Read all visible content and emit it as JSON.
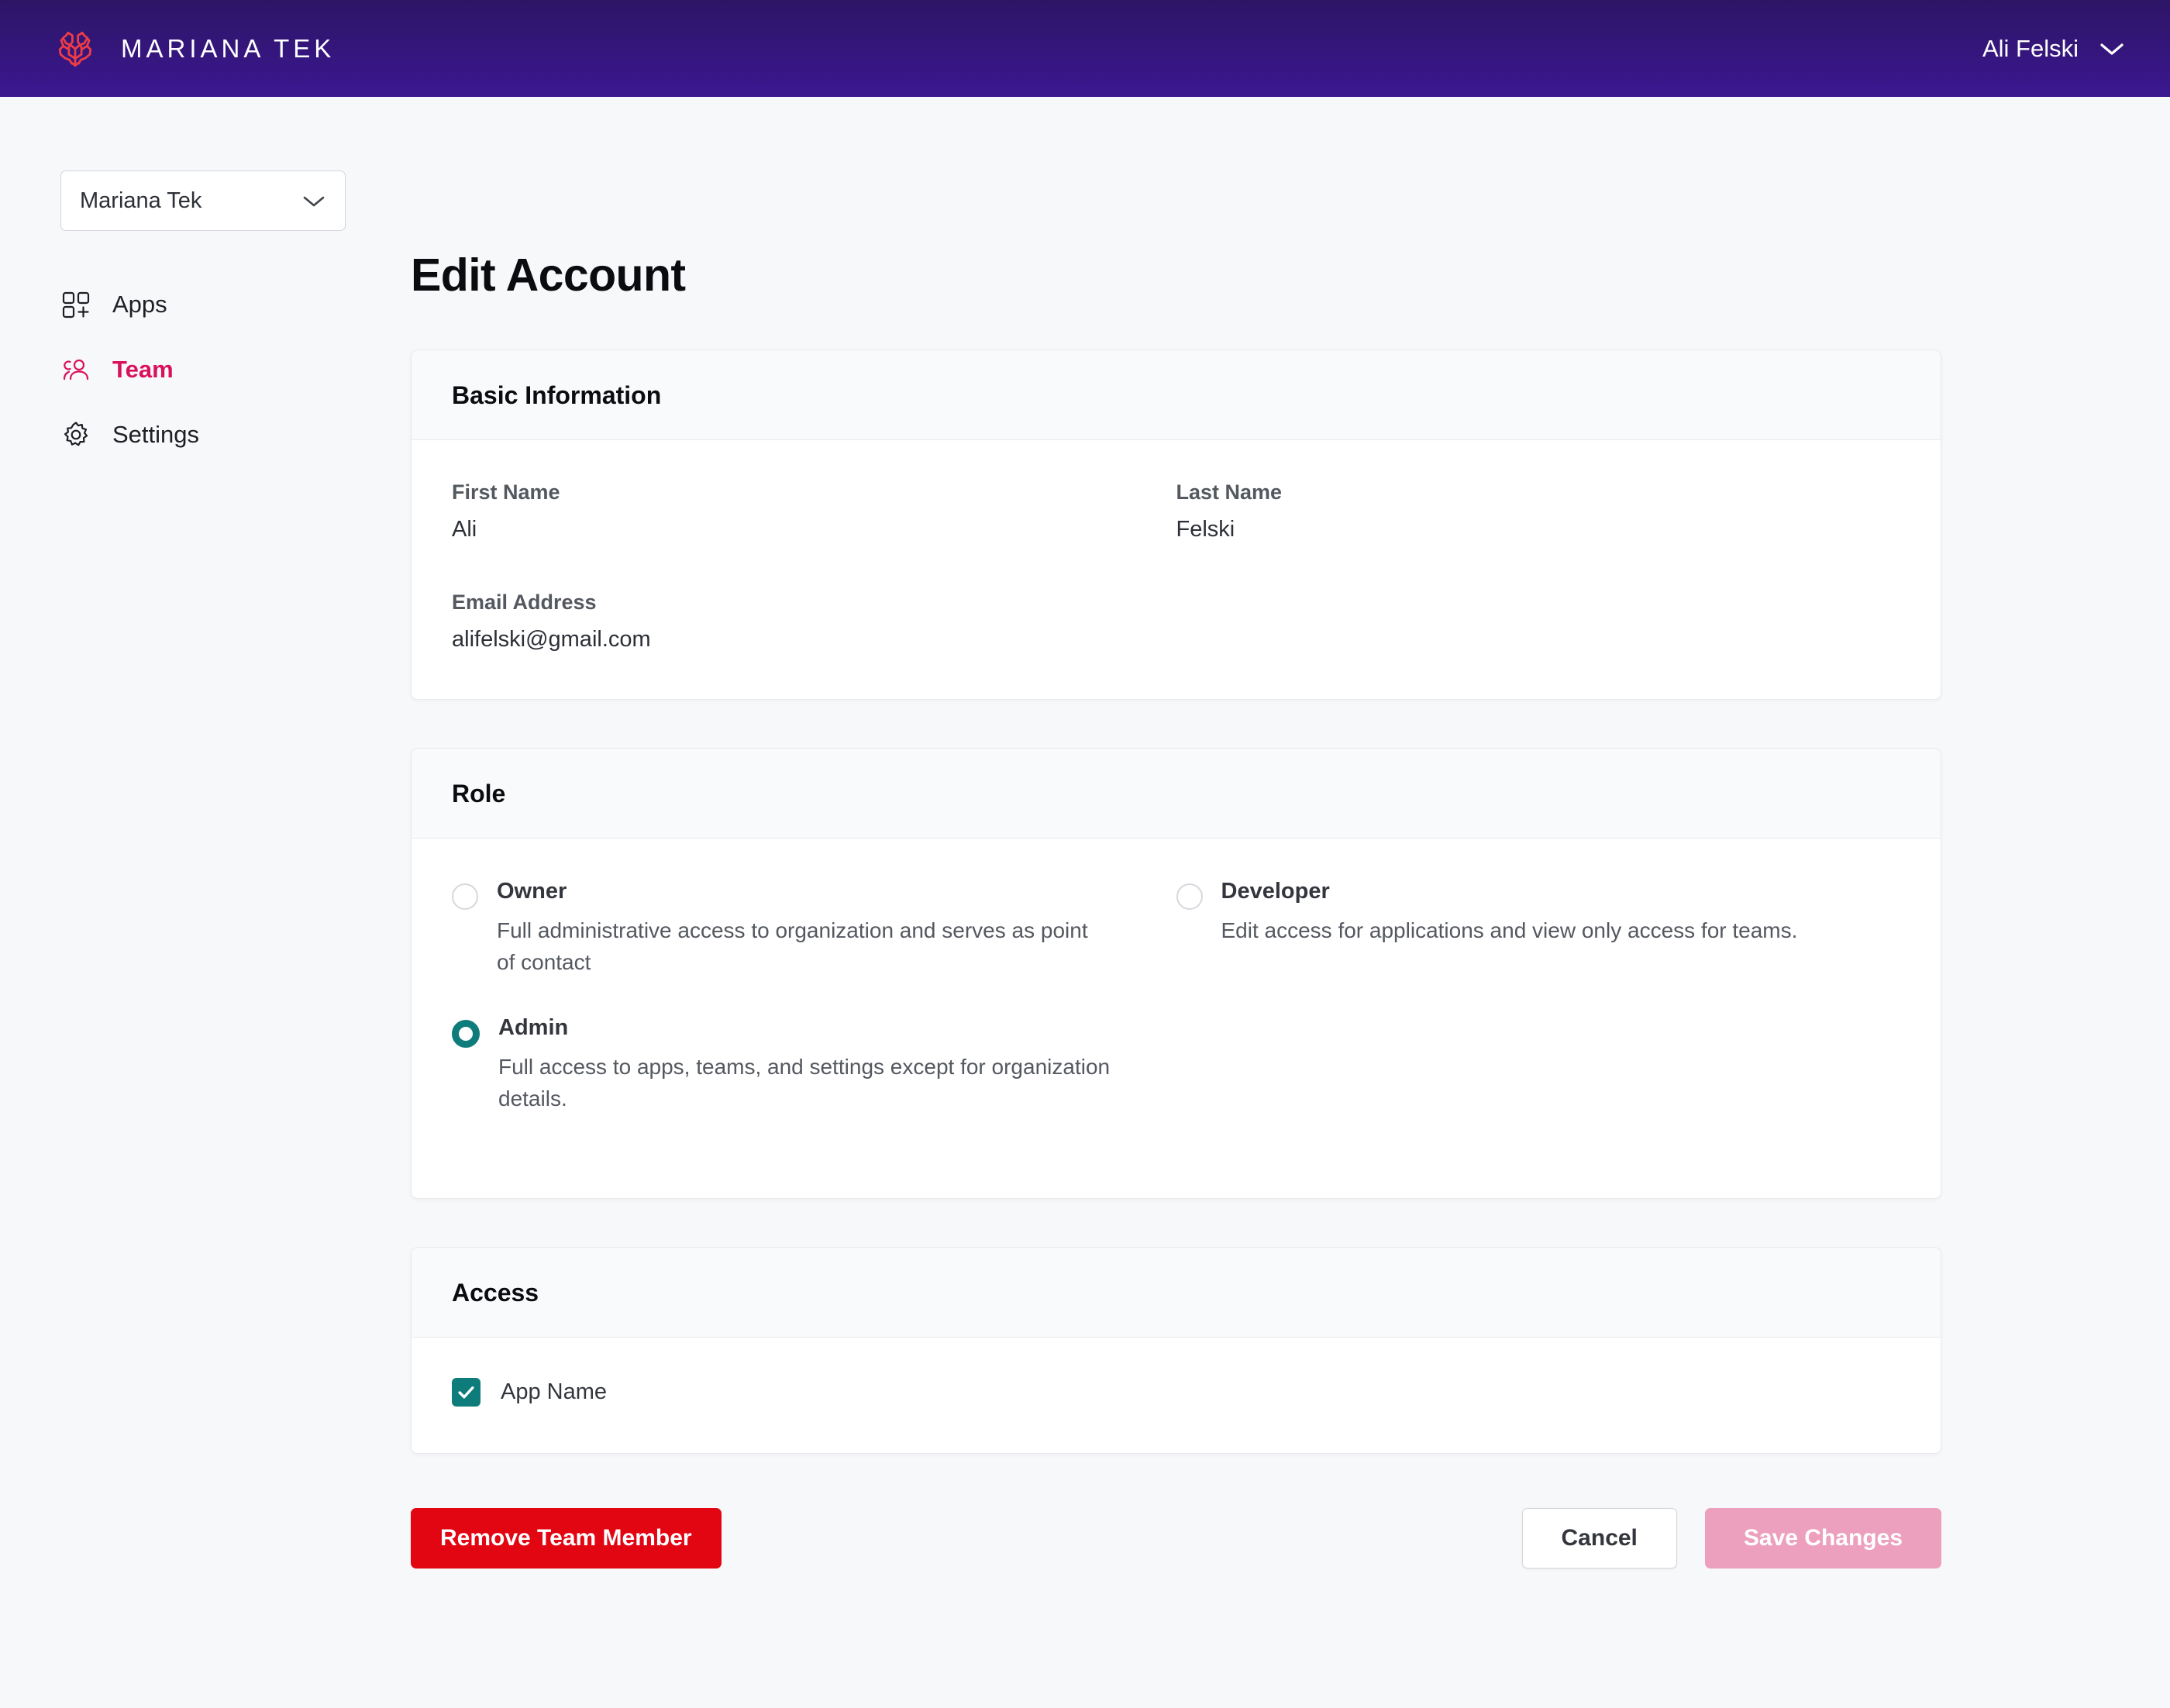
{
  "header": {
    "brand_name": "MARIANA TEK",
    "brand_icon": "coral-logo-icon",
    "user_name": "Ali Felski",
    "user_chevron_icon": "chevron-down-icon"
  },
  "sidebar": {
    "org_selector": {
      "value": "Mariana Tek",
      "chevron_icon": "chevron-down-icon"
    },
    "items": [
      {
        "label": "Apps",
        "icon": "apps-grid-icon",
        "active": false
      },
      {
        "label": "Team",
        "icon": "team-people-icon",
        "active": true
      },
      {
        "label": "Settings",
        "icon": "gear-icon",
        "active": false
      }
    ]
  },
  "main": {
    "page_title": "Edit Account",
    "basic_information": {
      "title": "Basic Information",
      "first_name_label": "First Name",
      "first_name_value": "Ali",
      "last_name_label": "Last Name",
      "last_name_value": "Felski",
      "email_label": "Email Address",
      "email_value": "alifelski@gmail.com"
    },
    "role": {
      "title": "Role",
      "options": [
        {
          "name": "Owner",
          "description": "Full administrative access to organization and serves as point of contact",
          "selected": false
        },
        {
          "name": "Developer",
          "description": "Edit access for applications and view only access for teams.",
          "selected": false
        },
        {
          "name": "Admin",
          "description": "Full access to apps, teams, and settings except for organization details.",
          "selected": true
        }
      ]
    },
    "access": {
      "title": "Access",
      "items": [
        {
          "label": "App Name",
          "checked": true
        }
      ]
    },
    "actions": {
      "remove_label": "Remove Team Member",
      "cancel_label": "Cancel",
      "save_label": "Save Changes"
    }
  },
  "colors": {
    "header_gradient_top": "#2d1566",
    "header_gradient_bottom": "#3b1790",
    "brand_accent": "#ef3c45",
    "active_nav": "#d8115c",
    "teal_selected": "#0e7c7b",
    "danger": "#e20613",
    "save_disabled": "#eda0bd",
    "page_background": "#f7f8fa"
  }
}
